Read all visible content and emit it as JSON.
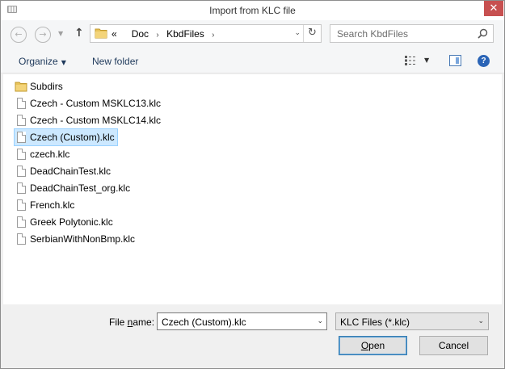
{
  "window": {
    "title": "Import from KLC file",
    "close_label": "✕"
  },
  "nav": {
    "back_glyph": "←",
    "forward_glyph": "→",
    "recent_glyph": "▼",
    "up_glyph": "↑",
    "breadcrumb": {
      "overflow": "«",
      "items": [
        "Doc",
        "KbdFiles"
      ],
      "separator": "›"
    },
    "address_dropdown_glyph": "⌄",
    "refresh_glyph": "↻",
    "search_placeholder": "Search KbdFiles"
  },
  "toolbar": {
    "organize_label": "Organize",
    "organize_caret": "▼",
    "new_folder_label": "New folder",
    "views_caret": "▼",
    "help_glyph": "?"
  },
  "files": [
    {
      "name": "Subdirs",
      "type": "folder",
      "selected": false
    },
    {
      "name": "Czech - Custom MSKLC13.klc",
      "type": "file",
      "selected": false
    },
    {
      "name": "Czech - Custom MSKLC14.klc",
      "type": "file",
      "selected": false
    },
    {
      "name": "Czech (Custom).klc",
      "type": "file",
      "selected": true
    },
    {
      "name": "czech.klc",
      "type": "file",
      "selected": false
    },
    {
      "name": "DeadChainTest.klc",
      "type": "file",
      "selected": false
    },
    {
      "name": "DeadChainTest_org.klc",
      "type": "file",
      "selected": false
    },
    {
      "name": "French.klc",
      "type": "file",
      "selected": false
    },
    {
      "name": "Greek Polytonic.klc",
      "type": "file",
      "selected": false
    },
    {
      "name": "SerbianWithNonBmp.klc",
      "type": "file",
      "selected": false
    }
  ],
  "bottom": {
    "filename_label_pre": "File ",
    "filename_label_mnemonic": "n",
    "filename_label_post": "ame:",
    "filename_value": "Czech (Custom).klc",
    "filename_dropdown_glyph": "⌄",
    "filter_value": "KLC Files (*.klc)",
    "filter_dropdown_glyph": "⌄",
    "open_mnemonic": "O",
    "open_rest": "pen",
    "cancel_label": "Cancel"
  },
  "colors": {
    "selection_bg": "#cce8ff",
    "selection_border": "#99d1ff",
    "close_button": "#c75050",
    "link_text": "#1e395b",
    "folder": "#e8c35a"
  }
}
